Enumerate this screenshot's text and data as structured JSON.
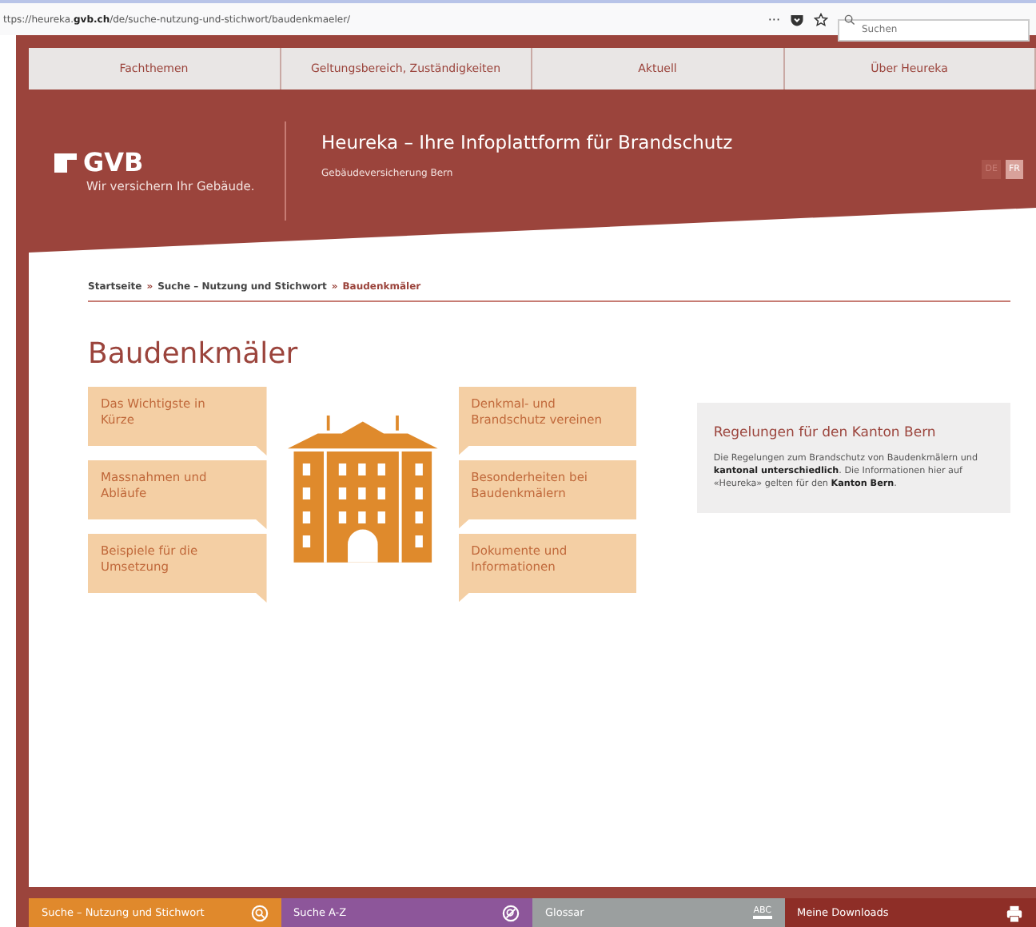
{
  "browser": {
    "url": "ttps://heureka.**gvb.ch**/de/suche-nutzung-und-stichwort/baudenkmaeler/",
    "menu": "···",
    "search": {
      "placeholder": "Suchen"
    }
  },
  "nav": [
    "Fachthemen",
    "Geltungsbereich, Zuständigkeiten",
    "Aktuell",
    "Über Heureka"
  ],
  "header": {
    "logo": "GVB",
    "tagline": "Wir versichern Ihr Gebäude.",
    "title": "Heureka – Ihre Infoplattform für Brandschutz",
    "subtitle": "Gebäudeversicherung Bern",
    "languages": [
      {
        "label": "DE",
        "selected": true
      },
      {
        "label": "FR",
        "selected": false
      }
    ]
  },
  "breadcrumb_separator": "»",
  "breadcrumb": [
    {
      "label": "Startseite",
      "current": false
    },
    {
      "label": "Suche – Nutzung und Stichwort",
      "current": false
    },
    {
      "label": "Baudenkmäler",
      "current": true
    }
  ],
  "page_title": "Baudenkmäler",
  "tiles_left": [
    "Das Wichtigste in Kürze",
    "Massnahmen und Abläufe",
    "Beispiele für die Umsetzung"
  ],
  "tiles_right": [
    "Denkmal- und Brandschutz vereinen",
    "Besonderheiten bei Baudenkmälern",
    "Dokumente und Informationen"
  ],
  "info": {
    "title": "Regelungen für den Kanton Bern",
    "text": "Die Regelungen zum Brandschutz von Baudenkmälern und **kantonal unterschiedlich**. Die Informationen hier auf «Heureka» gelten für den **Kanton Bern**."
  },
  "bottom_bar": [
    {
      "label": "Suche – Nutzung und Stichwort",
      "kind": "search",
      "color": "#e0892c"
    },
    {
      "label": "Suche A-Z",
      "kind": "az",
      "color": "#8d569a"
    },
    {
      "label": "Glossar",
      "kind": "glossary",
      "icon_text": "ABC",
      "color": "#9b9f9f"
    },
    {
      "label": "Meine Downloads",
      "kind": "downloads",
      "color": "#8e2e27"
    }
  ]
}
